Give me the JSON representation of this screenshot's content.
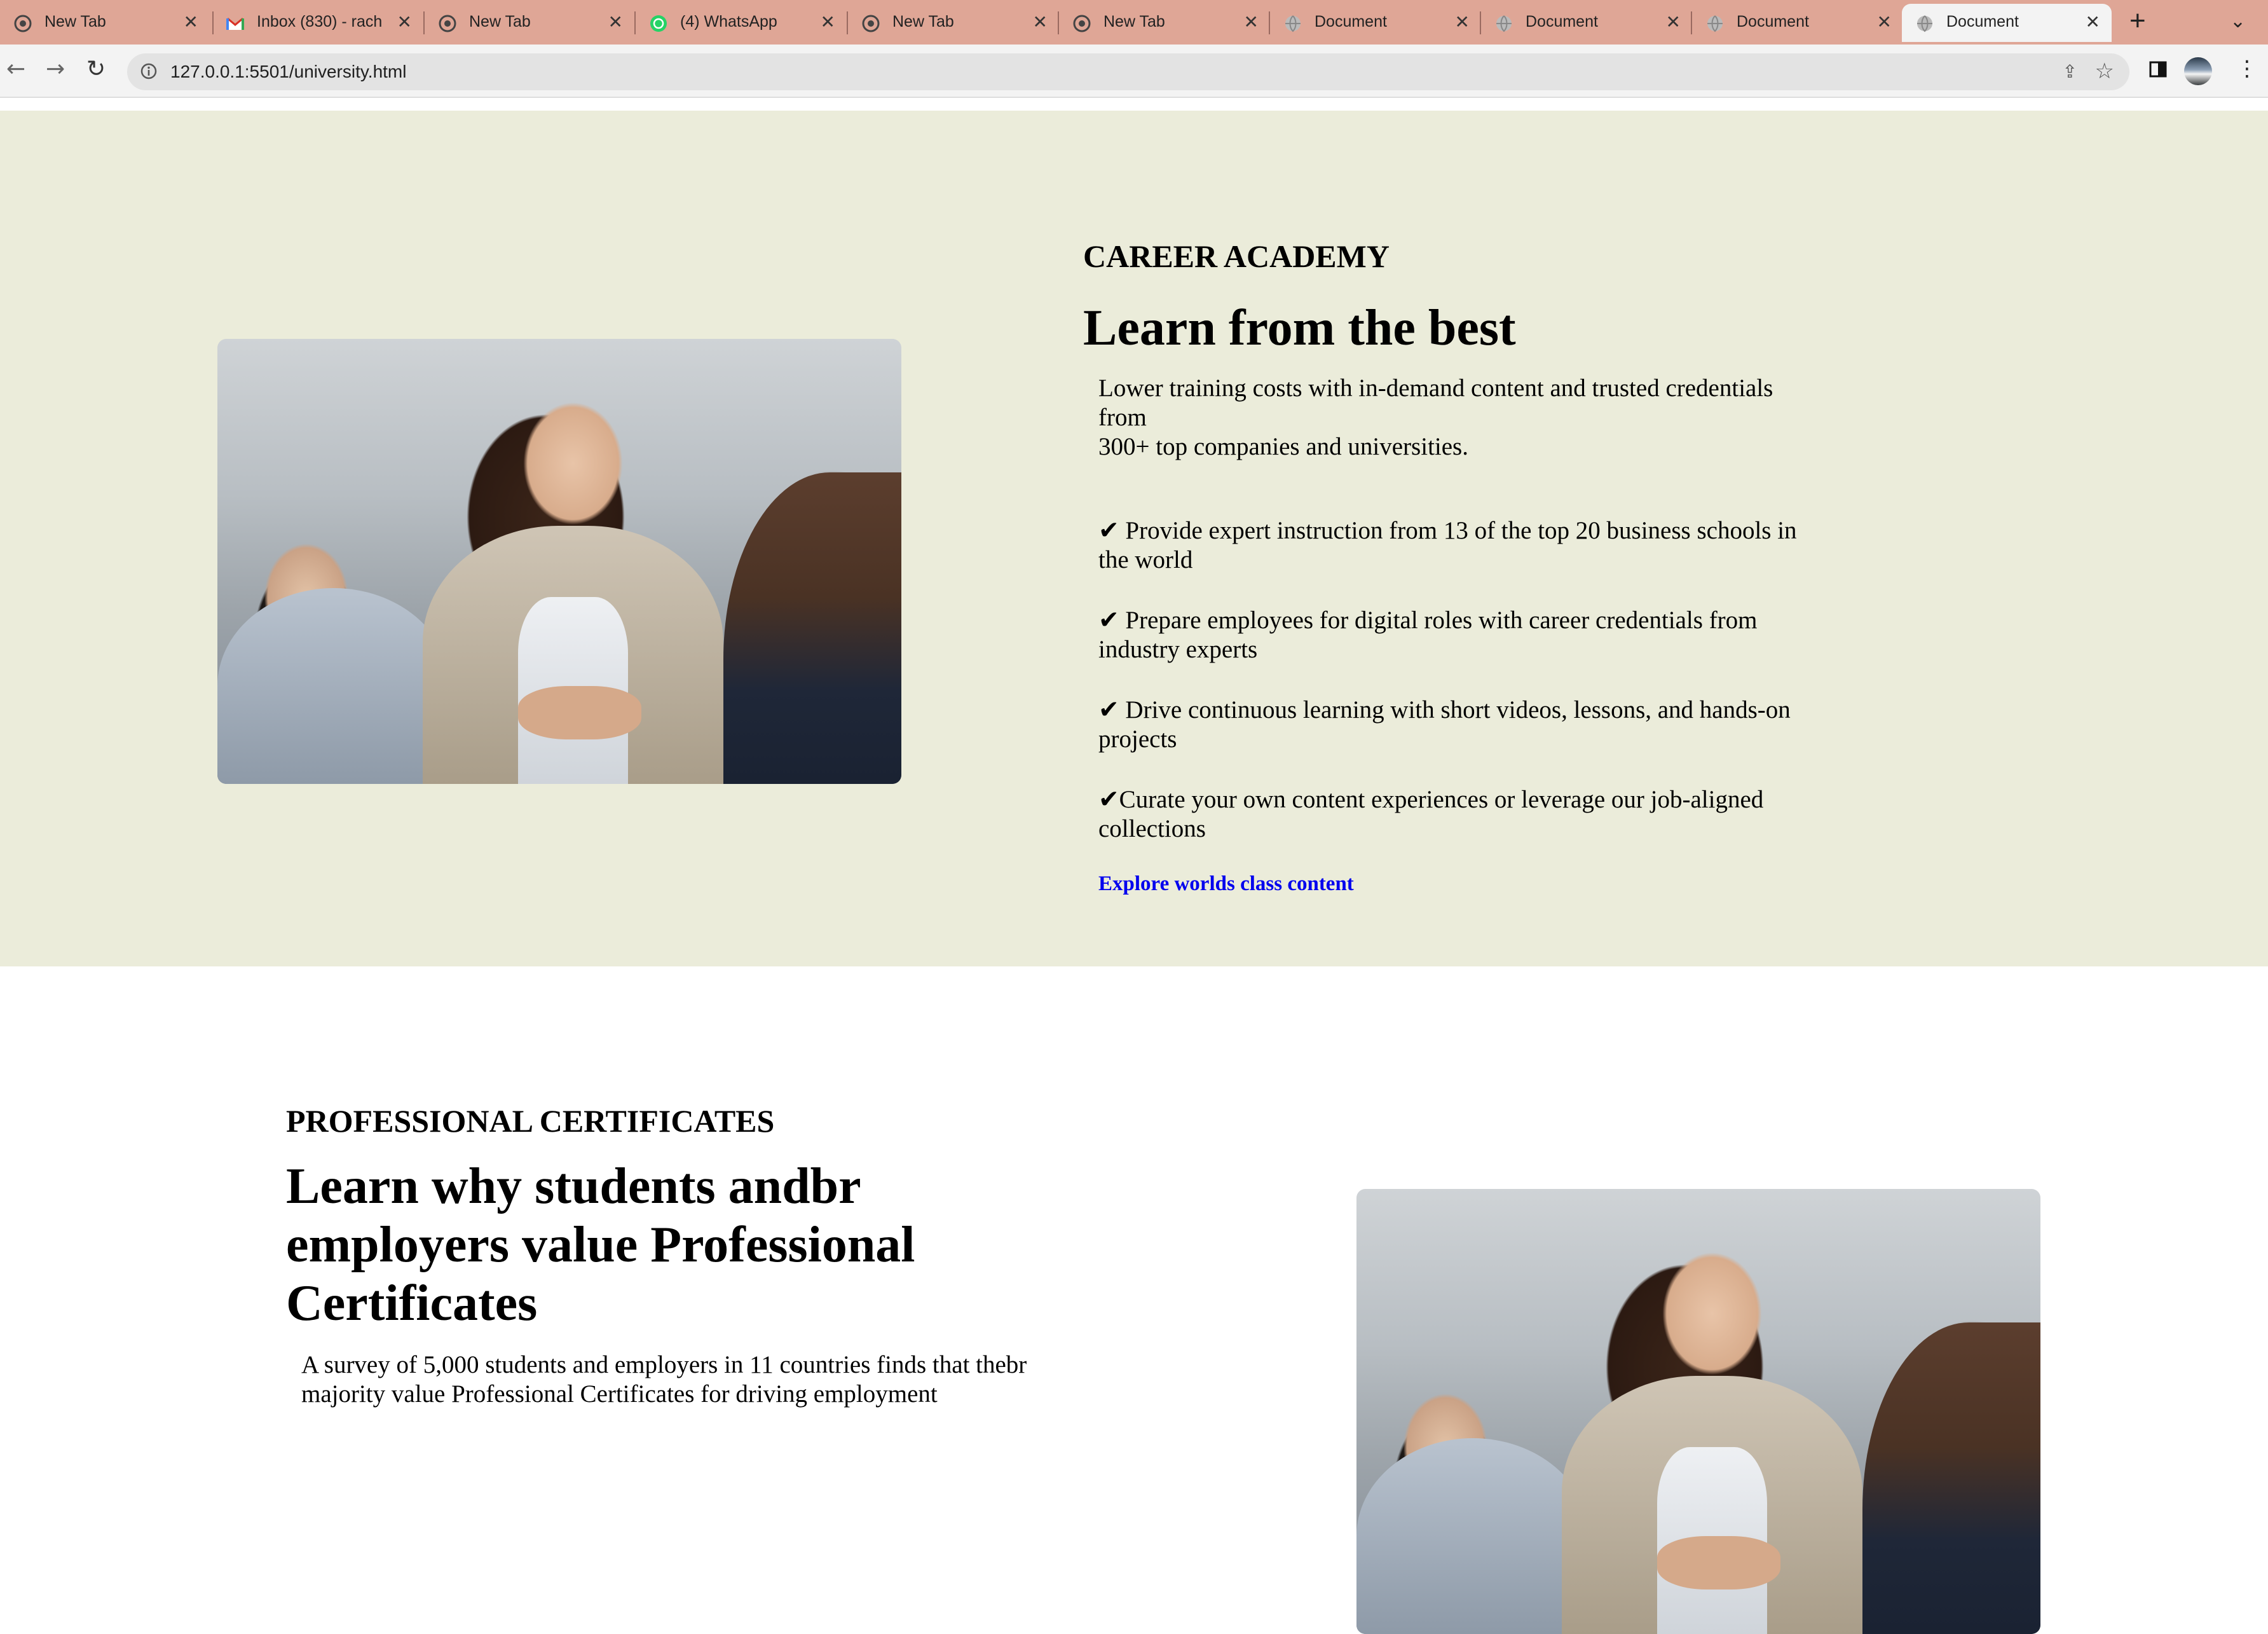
{
  "browser": {
    "tabs": [
      {
        "title": "New Tab",
        "icon": "chrome-icon"
      },
      {
        "title": "Inbox (830) - rach",
        "icon": "gmail-icon"
      },
      {
        "title": "New Tab",
        "icon": "chrome-icon"
      },
      {
        "title": "(4) WhatsApp",
        "icon": "whatsapp-icon"
      },
      {
        "title": "New Tab",
        "icon": "chrome-icon"
      },
      {
        "title": "New Tab",
        "icon": "chrome-icon"
      },
      {
        "title": "Document",
        "icon": "globe-icon"
      },
      {
        "title": "Document",
        "icon": "globe-icon"
      },
      {
        "title": "Document",
        "icon": "globe-icon"
      },
      {
        "title": "Document",
        "icon": "globe-icon"
      }
    ],
    "url": "127.0.0.1:5501/university.html"
  },
  "career": {
    "eyebrow": "CAREER ACADEMY",
    "heading": "Learn from the best",
    "intro_line1": "Lower training costs with in-demand content and trusted credentials",
    "intro_line2": "from",
    "intro_line3": "300+ top companies and universities.",
    "bullets": [
      "✔ Provide expert instruction from 13 of the top 20 business schools in the world",
      "✔ Prepare employees for digital roles with career credentials from industry experts",
      "✔ Drive continuous learning with short videos, lessons, and hands-on projects",
      "✔Curate your own content experiences or leverage our job-aligned collections"
    ],
    "link": "Explore worlds class content"
  },
  "certificates": {
    "eyebrow": "PROFESSIONAL CERTIFICATES",
    "heading_line1": "Learn why students andbr",
    "heading_line2": "employers value Professional",
    "heading_line3": "Certificates",
    "body_line1": "A survey of 5,000 students and employers in 11 countries finds that thebr",
    "body_line2": "majority value Professional Certificates for driving employment"
  },
  "colors": {
    "tabstrip": "#dfa696",
    "section_bg": "#ebecda",
    "link": "#0000ee"
  }
}
